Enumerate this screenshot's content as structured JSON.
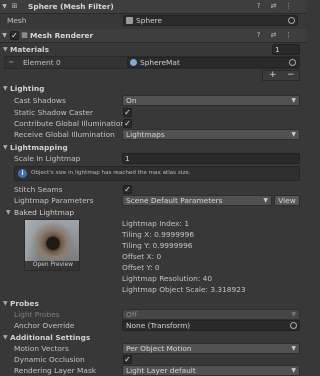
{
  "mesh_filter": {
    "title": "Sphere (Mesh Filter)",
    "mesh_label": "Mesh",
    "mesh_value": "Sphere"
  },
  "mesh_renderer": {
    "title": "Mesh Renderer",
    "materials_label": "Materials",
    "materials_count": "1",
    "element_label": "Element 0",
    "element_value": "SphereMat",
    "add_label": "+",
    "remove_label": "−"
  },
  "lighting": {
    "header": "Lighting",
    "cast_shadows_label": "Cast Shadows",
    "cast_shadows_value": "On",
    "static_caster_label": "Static Shadow Caster",
    "contribute_gi_label": "Contribute Global Illumination",
    "receive_gi_label": "Receive Global Illumination",
    "receive_gi_value": "Lightmaps"
  },
  "lightmapping": {
    "header": "Lightmapping",
    "scale_label": "Scale In Lightmap",
    "scale_value": "1",
    "info_text": "Object's size in lightmap has reached the max atlas size.",
    "stitch_label": "Stitch Seams",
    "params_label": "Lightmap Parameters",
    "params_value": "Scene Default Parameters",
    "view_label": "View",
    "baked_label": "Baked Lightmap",
    "open_preview_label": "Open Preview",
    "stats": [
      "Lightmap Index: 1",
      "Tiling X: 0.9999996",
      "Tiling Y: 0.9999996",
      "Offset X: 0",
      "Offset Y: 0",
      "Lightmap Resolution: 40",
      "Lightmap Object Scale: 3.318923"
    ]
  },
  "probes": {
    "header": "Probes",
    "light_probes_label": "Light Probes",
    "light_probes_value": "Off",
    "anchor_label": "Anchor Override",
    "anchor_value": "None (Transform)"
  },
  "additional": {
    "header": "Additional Settings",
    "motion_label": "Motion Vectors",
    "motion_value": "Per Object Motion",
    "dynamic_occlusion_label": "Dynamic Occlusion",
    "rendering_layer_label": "Rendering Layer Mask",
    "rendering_layer_value": "Light Layer default"
  },
  "colors": {
    "background": "#383838",
    "header": "#3e3e3e",
    "field": "#2a2a2a",
    "accent": "#7fa9d6"
  },
  "icons": [
    "fold-arrow-icon",
    "mesh-filter-icon",
    "mesh-renderer-icon",
    "help-icon",
    "preset-icon",
    "menu-icon",
    "mesh-icon",
    "material-icon",
    "info-icon",
    "object-picker-icon"
  ]
}
